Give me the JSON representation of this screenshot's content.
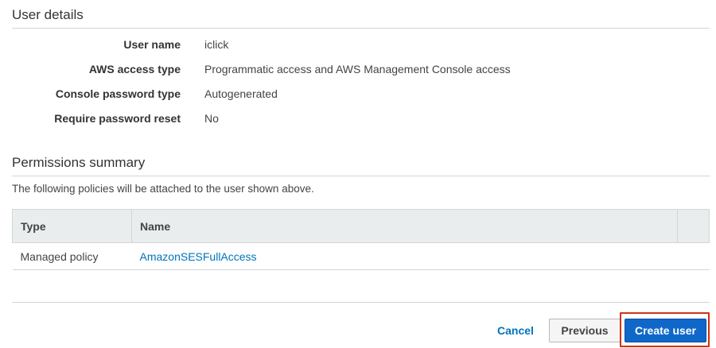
{
  "user_details": {
    "title": "User details",
    "rows": [
      {
        "label": "User name",
        "value": "iclick"
      },
      {
        "label": "AWS access type",
        "value": "Programmatic access and AWS Management Console access"
      },
      {
        "label": "Console password type",
        "value": "Autogenerated"
      },
      {
        "label": "Require password reset",
        "value": "No"
      }
    ]
  },
  "permissions": {
    "title": "Permissions summary",
    "intro": "The following policies will be attached to the user shown above.",
    "columns": [
      "Type",
      "Name"
    ],
    "rows": [
      {
        "type": "Managed policy",
        "name": "AmazonSESFullAccess"
      }
    ]
  },
  "footer": {
    "cancel_label": "Cancel",
    "previous_label": "Previous",
    "create_label": "Create user"
  },
  "colors": {
    "link": "#0073bb",
    "primary": "#0f68c9",
    "highlight": "#d13212"
  }
}
